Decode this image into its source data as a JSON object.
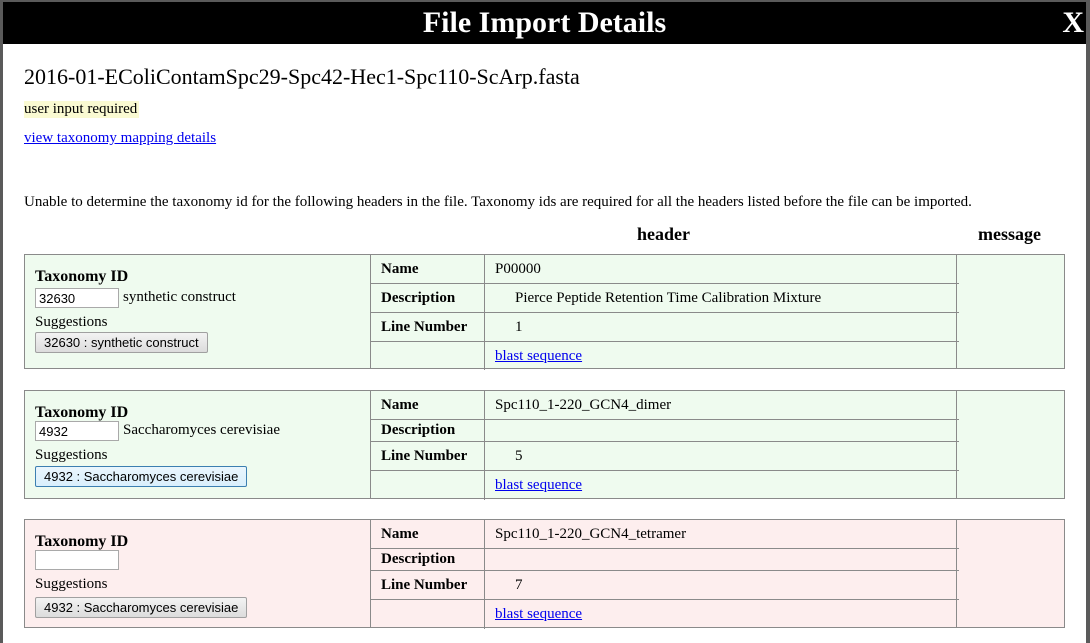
{
  "dialog": {
    "title": "File Import Details",
    "close_label": "X",
    "filename": "2016-01-EColiContamSpc29-Spc42-Hec1-Spc110-ScArp.fasta",
    "status": "user input required",
    "taxonomy_link": "view taxonomy mapping details",
    "intro": "Unable to determine the taxonomy id for the following headers in the file. Taxonomy ids are required for all the headers listed before the file can be imported.",
    "columns": {
      "header": "header",
      "message": "message"
    }
  },
  "labels": {
    "taxonomy_id": "Taxonomy ID",
    "suggestions": "Suggestions",
    "name": "Name",
    "description": "Description",
    "line_number": "Line Number",
    "blast": "blast sequence"
  },
  "entries": [
    {
      "taxonomy_id": "32630",
      "taxonomy_name": "synthetic construct",
      "suggestion": "32630 : synthetic construct",
      "name": "P00000",
      "description": "Pierce Peptide Retention Time Calibration Mixture",
      "line_number": "1",
      "status_color": "#effbef"
    },
    {
      "taxonomy_id": "4932",
      "taxonomy_name": "Saccharomyces cerevisiae",
      "suggestion": "4932 : Saccharomyces cerevisiae",
      "name": "Spc110_1-220_GCN4_dimer",
      "description": "",
      "line_number": "5",
      "status_color": "#effbef"
    },
    {
      "taxonomy_id": "",
      "taxonomy_name": "",
      "suggestion": "4932 : Saccharomyces cerevisiae",
      "name": "Spc110_1-220_GCN4_tetramer",
      "description": "",
      "line_number": "7",
      "status_color": "#fdeeee"
    }
  ]
}
